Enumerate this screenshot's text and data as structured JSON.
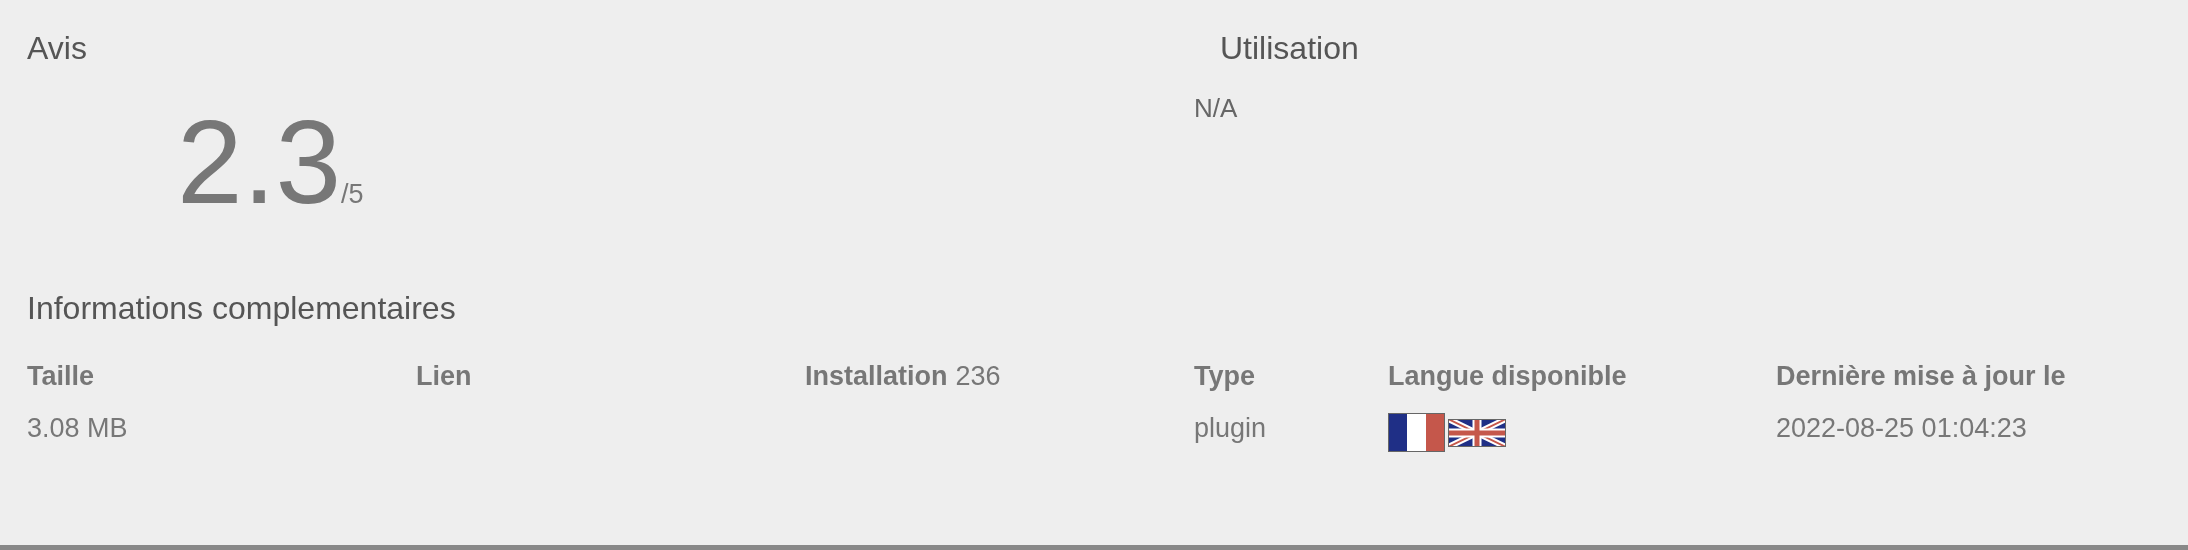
{
  "reviews": {
    "title": "Avis",
    "score": "2.3",
    "scale": "/5"
  },
  "usage": {
    "title": "Utilisation",
    "value": "N/A"
  },
  "details": {
    "title": "Informations complementaires",
    "columns": [
      {
        "kind": "text",
        "header": "Taille",
        "value": "3.08 MB"
      },
      {
        "kind": "text",
        "header": "Lien"
      },
      {
        "kind": "count",
        "header": "Installation",
        "count": "236"
      },
      {
        "kind": "text",
        "header": "Type",
        "value": "plugin"
      },
      {
        "kind": "flags",
        "header": "Langue disponible",
        "flags": [
          {
            "kind": "fr"
          },
          {
            "kind": "gb"
          }
        ]
      },
      {
        "kind": "text",
        "header": "Dernière mise à jour le",
        "value": "2022-08-25 01:04:23"
      }
    ]
  }
}
